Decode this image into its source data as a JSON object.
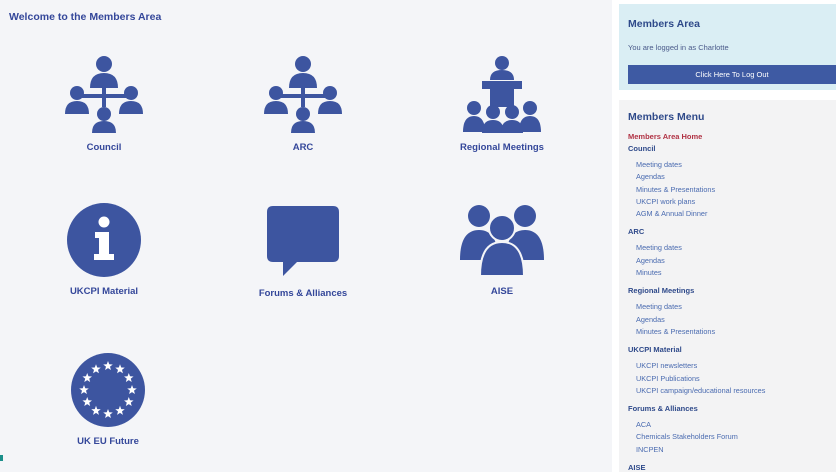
{
  "main": {
    "title": "Welcome to the Members Area",
    "tiles": [
      {
        "label": "Council",
        "icon": "council-hierarchy-icon"
      },
      {
        "label": "ARC",
        "icon": "arc-hierarchy-icon"
      },
      {
        "label": "Regional Meetings",
        "icon": "regional-meetings-podium-icon"
      },
      {
        "label": "UKCPI Material",
        "icon": "info-icon"
      },
      {
        "label": "Forums & Alliances",
        "icon": "speech-bubble-icon"
      },
      {
        "label": "AISE",
        "icon": "group-people-icon"
      },
      {
        "label": "UK EU Future",
        "icon": "eu-stars-icon"
      }
    ]
  },
  "sidebar": {
    "login": {
      "title": "Members Area",
      "status": "You are logged in as Charlotte",
      "logout_label": "Click Here To Log Out"
    },
    "menu": {
      "title": "Members Menu",
      "home": "Members Area Home",
      "sections": [
        {
          "label": "Council",
          "items": [
            "Meeting dates",
            "Agendas",
            "Minutes & Presentations",
            "UKCPI work plans",
            "AGM & Annual Dinner"
          ]
        },
        {
          "label": "ARC",
          "items": [
            "Meeting dates",
            "Agendas",
            "Minutes"
          ]
        },
        {
          "label": "Regional Meetings",
          "items": [
            "Meeting dates",
            "Agendas",
            "Minutes & Presentations"
          ]
        },
        {
          "label": "UKCPI Material",
          "items": [
            "UKCPI newsletters",
            "UKCPI Publications",
            "UKCPI campaign/educational resources"
          ]
        },
        {
          "label": "Forums & Alliances",
          "items": [
            "ACA",
            "Chemicals Stakeholders Forum",
            "INCPEN"
          ]
        },
        {
          "label": "AISE",
          "items": []
        }
      ]
    }
  },
  "colors": {
    "brand_blue": "#34479a",
    "icon_blue": "#3d55a0",
    "home_link_red": "#b03244",
    "login_panel_bg": "#daeef4",
    "menu_panel_bg": "#f3f3f4"
  }
}
